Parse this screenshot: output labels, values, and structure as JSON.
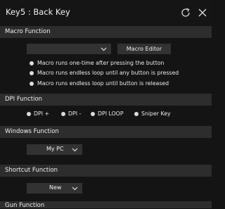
{
  "window": {
    "title": "Key5 : Back Key"
  },
  "macro": {
    "header": "Macro Function",
    "dropdown_value": "",
    "editor_button": "Macro Editor",
    "options": [
      "Macro runs one-time after pressing the button",
      "Macro runs endless loop until any button is pressed",
      "Macro runs endless loop until button is released"
    ]
  },
  "dpi": {
    "header": "DPI Function",
    "options": [
      "DPI +",
      "DPI -",
      "DPI LOOP",
      "Sniper Key"
    ]
  },
  "windows_fn": {
    "header": "Windows Function",
    "value": "My PC"
  },
  "shortcut": {
    "header": "Shortcut Function",
    "value": "New"
  },
  "gun": {
    "header": "Gun Function"
  },
  "icons": {
    "refresh": "refresh-icon",
    "close": "close-icon",
    "chevron": "chevron-down-icon"
  },
  "colors": {
    "background": "#141414",
    "section_header": "#2d2d2d",
    "control": "#323232",
    "text": "#ececec"
  }
}
